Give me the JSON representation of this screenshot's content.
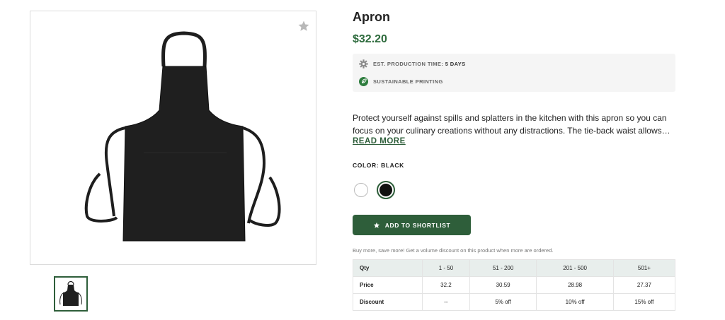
{
  "product": {
    "title": "Apron",
    "price": "$32.20",
    "features": [
      {
        "icon": "gear-icon",
        "label": "EST. PRODUCTION TIME:",
        "value": "5 DAYS"
      },
      {
        "icon": "leaf-icon",
        "label": "SUSTAINABLE PRINTING"
      }
    ],
    "description": "Protect yourself against spills and splatters in the kitchen with this apron so you can focus on your culinary creations without any distractions. The tie-back waist allows…",
    "read_more": "READ MORE",
    "color_label": "COLOR: BLACK",
    "colors": [
      {
        "name": "white",
        "hex": "#ffffff",
        "selected": false
      },
      {
        "name": "black",
        "hex": "#111111",
        "selected": true
      }
    ],
    "shortlist_button": "ADD TO SHORTLIST",
    "volume_note": "Buy more, save more! Get a volume discount on this product when more are ordered."
  },
  "pricing_table": {
    "headers": [
      "Qty",
      "1 - 50",
      "51 - 200",
      "201 - 500",
      "501+"
    ],
    "rows": [
      [
        "Price",
        "32.2",
        "30.59",
        "28.98",
        "27.37"
      ],
      [
        "Discount",
        "--",
        "5% off",
        "10% off",
        "15% off"
      ]
    ]
  },
  "colors": {
    "accent": "#2e5e3a",
    "price": "#2e6b3d",
    "table_header_bg": "#e8eeec"
  }
}
